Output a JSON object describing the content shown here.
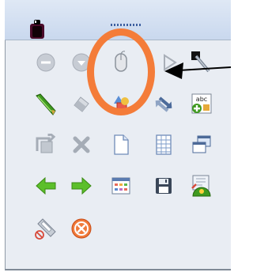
{
  "titlebar": {
    "grip": "drag-handle"
  },
  "toolbar": {
    "rows": [
      [
        {
          "name": "minus-circle-icon"
        },
        {
          "name": "dropdown-circle-icon"
        },
        {
          "name": "mouse-icon"
        },
        {
          "name": "diamond-outline-icon"
        },
        {
          "name": "black-square-brush-icon"
        }
      ],
      [
        {
          "name": "green-pen-icon"
        },
        {
          "name": "eraser-icon"
        },
        {
          "name": "shapes-icon"
        },
        {
          "name": "swap-arrows-icon"
        },
        {
          "name": "spellcheck-add-icon",
          "label": "abc"
        }
      ],
      [
        {
          "name": "rotate-page-icon"
        },
        {
          "name": "delete-x-icon"
        },
        {
          "name": "new-page-icon"
        },
        {
          "name": "spreadsheet-icon"
        },
        {
          "name": "multi-window-icon"
        }
      ],
      [
        {
          "name": "arrow-left-icon"
        },
        {
          "name": "arrow-right-icon"
        },
        {
          "name": "calendar-grid-icon"
        },
        {
          "name": "floppy-disk-icon"
        },
        {
          "name": "screen-capture-icon"
        }
      ],
      [
        {
          "name": "mobile-phone-icon"
        },
        {
          "name": "close-red-circle-icon"
        }
      ]
    ]
  },
  "colors": {
    "highlight_ring": "#f47c39",
    "panel_bg": "#e9edf3",
    "arrow_green": "#5cbf2a"
  }
}
